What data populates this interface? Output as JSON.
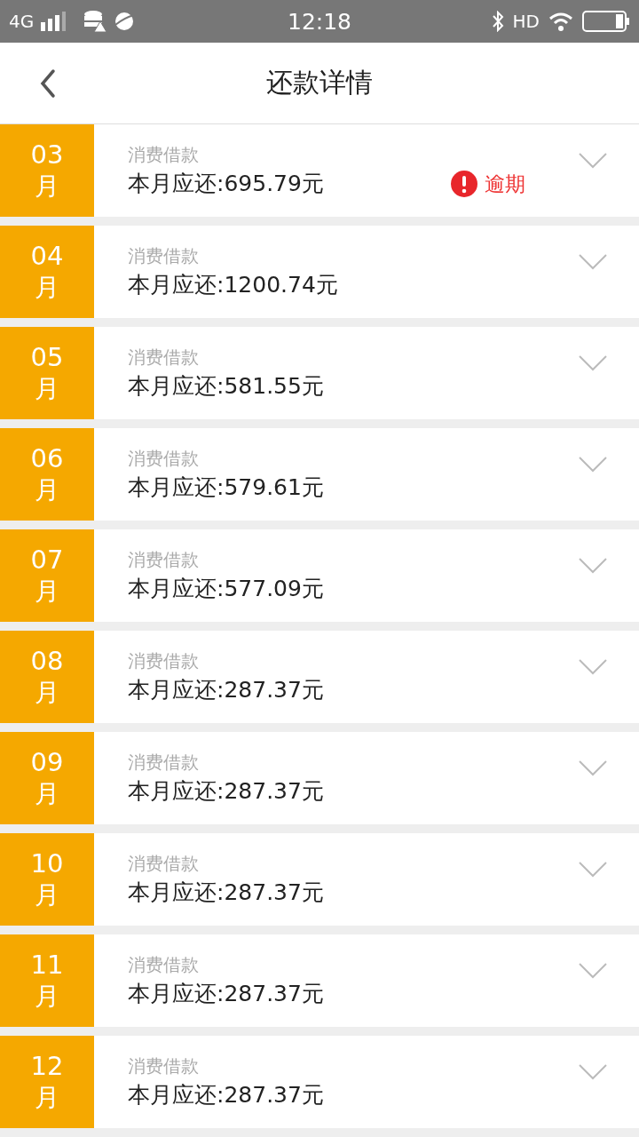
{
  "status_bar": {
    "network": "4G",
    "time": "12:18",
    "hd": "HD"
  },
  "header": {
    "title": "还款详情"
  },
  "rows": [
    {
      "month": "03",
      "unit": "月",
      "title": "消费借款",
      "amount": "本月应还:695.79元",
      "overdue": true,
      "overdue_label": "逾期"
    },
    {
      "month": "04",
      "unit": "月",
      "title": "消费借款",
      "amount": "本月应还:1200.74元",
      "overdue": false
    },
    {
      "month": "05",
      "unit": "月",
      "title": "消费借款",
      "amount": "本月应还:581.55元",
      "overdue": false
    },
    {
      "month": "06",
      "unit": "月",
      "title": "消费借款",
      "amount": "本月应还:579.61元",
      "overdue": false
    },
    {
      "month": "07",
      "unit": "月",
      "title": "消费借款",
      "amount": "本月应还:577.09元",
      "overdue": false
    },
    {
      "month": "08",
      "unit": "月",
      "title": "消费借款",
      "amount": "本月应还:287.37元",
      "overdue": false
    },
    {
      "month": "09",
      "unit": "月",
      "title": "消费借款",
      "amount": "本月应还:287.37元",
      "overdue": false
    },
    {
      "month": "10",
      "unit": "月",
      "title": "消费借款",
      "amount": "本月应还:287.37元",
      "overdue": false
    },
    {
      "month": "11",
      "unit": "月",
      "title": "消费借款",
      "amount": "本月应还:287.37元",
      "overdue": false
    },
    {
      "month": "12",
      "unit": "月",
      "title": "消费借款",
      "amount": "本月应还:287.37元",
      "overdue": false
    }
  ]
}
